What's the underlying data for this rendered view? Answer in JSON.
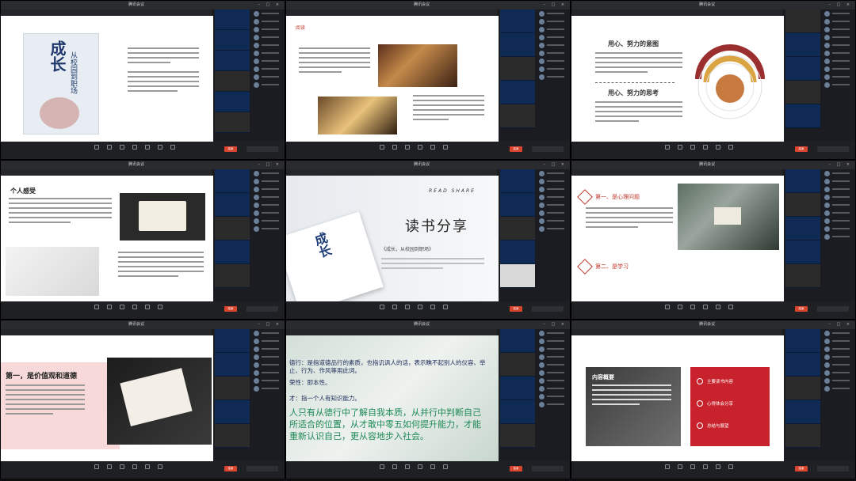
{
  "meeting": {
    "end_button": "结束",
    "tile_titles": [
      "腾讯会议",
      "腾讯会议",
      "腾讯会议",
      "腾讯会议",
      "腾讯会议",
      "腾讯会议",
      "腾讯会议",
      "腾讯会议",
      "腾讯会议"
    ]
  },
  "tile1": {
    "book_title": "成长",
    "book_subtitle": "从校园到职场"
  },
  "tile2": {
    "tag": "阅读"
  },
  "tile3": {
    "heading1": "用心、努力的意图",
    "heading2": "用心、努力的思考"
  },
  "tile4": {
    "heading": "个人感受"
  },
  "tile5": {
    "read_share": "READ SHARE",
    "title": "读书分享",
    "subtitle": "《成长，从校园到职场》",
    "book_title": "成长"
  },
  "tile6": {
    "point1": "第一、是心理问题",
    "point2": "第二、是学习"
  },
  "tile7": {
    "heading": "第一，是价值观和道德"
  },
  "tile8": {
    "line1": "德行：是指道德品行的素质，也指讥讽人的话，表示瞧不起别人的仪容、举止、行为、作风等用此词。",
    "line2": "荣性：即本性。",
    "line3": "才：指一个人有知识能力。",
    "highlight": "人只有从德行中了解自我本质，从并行中判断自己所适合的位置，从才敢中零五如何提升能力，才能重新认识自己，更从容地步入社会。"
  },
  "tile9": {
    "box_title": "内容概要",
    "items": [
      "主要读书内容",
      "心得体会分享",
      "总结与展望"
    ]
  }
}
